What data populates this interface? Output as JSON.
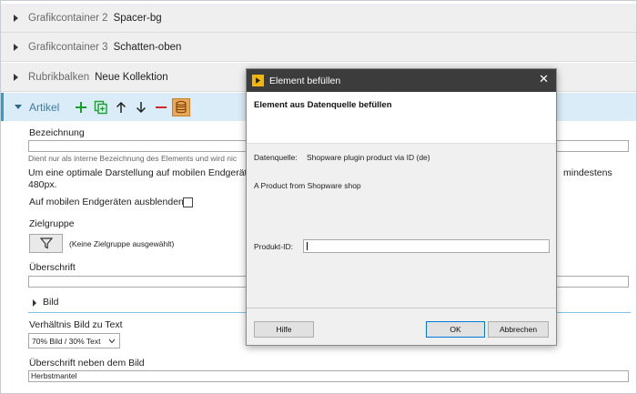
{
  "accordion": [
    {
      "type": "Grafikcontainer 2",
      "name": "Spacer-bg"
    },
    {
      "type": "Grafikcontainer 3",
      "name": "Schatten-oben"
    },
    {
      "type": "Rubrikbalken",
      "name": "Neue Kollektion"
    }
  ],
  "artikel": {
    "type": "Artikel",
    "toolbar_icons": [
      "plus-icon",
      "copy-icon",
      "arrow-up-icon",
      "arrow-down-icon",
      "minus-icon",
      "database-icon"
    ]
  },
  "form": {
    "bezeichnung_label": "Bezeichnung",
    "bezeichnung_hint": "Dient nur als interne Bezeichnung des Elements und wird nic",
    "mobile_text_left": "Um eine optimale Darstellung auf mobilen Endgeräten z",
    "mobile_text_right": "mindestens",
    "mobile_text_line2": "480px.",
    "hide_mobile_label": "Auf mobilen Endgeräten ausblenden",
    "zielgruppe_label": "Zielgruppe",
    "zielgruppe_value": "(Keine Zielgruppe ausgewählt)",
    "ueberschrift_label": "Überschrift",
    "bild_label": "Bild",
    "verhaeltnis_label": "Verhältnis Bild zu Text",
    "verhaeltnis_value": "70% Bild / 30% Text",
    "ueberschrift_bild_label": "Überschrift neben dem Bild",
    "ueberschrift_bild_value": "Herbstmantel"
  },
  "dialog": {
    "title": "Element befüllen",
    "heading": "Element aus Datenquelle befüllen",
    "datenquelle_label": "Datenquelle:",
    "datenquelle_value": "Shopware plugin product via ID (de)",
    "description": "A Product from Shopware shop",
    "produkt_label": "Produkt-ID:",
    "produkt_value": "",
    "help_button": "Hilfe",
    "ok_button": "OK",
    "cancel_button": "Abbrechen"
  },
  "colors": {
    "accent": "#2a9fd6",
    "dialog_titlebar": "#3c3c3c",
    "toolbar_green": "#1a9e2a",
    "toolbar_red": "#d9262c",
    "database_orange": "#e9a75a"
  }
}
